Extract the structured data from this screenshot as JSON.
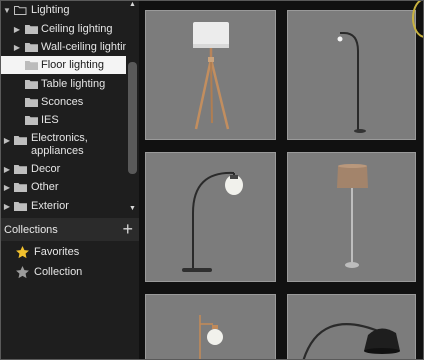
{
  "tree": {
    "items": [
      {
        "label": "Lighting",
        "expander": "▼",
        "icon": "folder-open-icon"
      },
      {
        "label": "Ceiling lighting",
        "expander": "▶",
        "icon": "folder-icon"
      },
      {
        "label": "Wall-ceiling lighting",
        "expander": "▶",
        "icon": "folder-icon"
      },
      {
        "label": "Floor lighting",
        "expander": "",
        "icon": "folder-icon",
        "selected": true
      },
      {
        "label": "Table lighting",
        "expander": "",
        "icon": "folder-icon"
      },
      {
        "label": "Sconces",
        "expander": "",
        "icon": "folder-icon"
      },
      {
        "label": "IES",
        "expander": "",
        "icon": "folder-icon"
      },
      {
        "label_line1": "Electronics,",
        "label_line2": "appliances",
        "expander": "▶",
        "icon": "folder-icon"
      },
      {
        "label": "Decor",
        "expander": "▶",
        "icon": "folder-icon"
      },
      {
        "label": "Other",
        "expander": "▶",
        "icon": "folder-icon"
      },
      {
        "label": "Exterior",
        "expander": "▶",
        "icon": "folder-icon"
      }
    ],
    "scroll_up": "▲",
    "scroll_down": "▼"
  },
  "collections": {
    "title": "Collections",
    "add_label": "+",
    "items": [
      {
        "label": "Favorites",
        "icon": "star-gold-icon",
        "color": "#f2c12e"
      },
      {
        "label": "Collection",
        "icon": "star-gray-icon",
        "color": "#9b9b9b"
      }
    ]
  },
  "colors": {
    "selected_bg": "#f4f4f4",
    "thumb_bg": "#7c7c7c",
    "folder": "#bfbfbf"
  },
  "gallery": {
    "items": [
      {
        "icon": "floor-lamp-tripod-icon"
      },
      {
        "icon": "floor-lamp-arc-thin-icon"
      },
      {
        "icon": "floor-lamp-arc-globe-icon"
      },
      {
        "icon": "floor-lamp-column-shade-icon"
      },
      {
        "icon": "floor-lamp-globe-bulb-icon"
      },
      {
        "icon": "floor-lamp-arc-dome-icon"
      }
    ]
  }
}
